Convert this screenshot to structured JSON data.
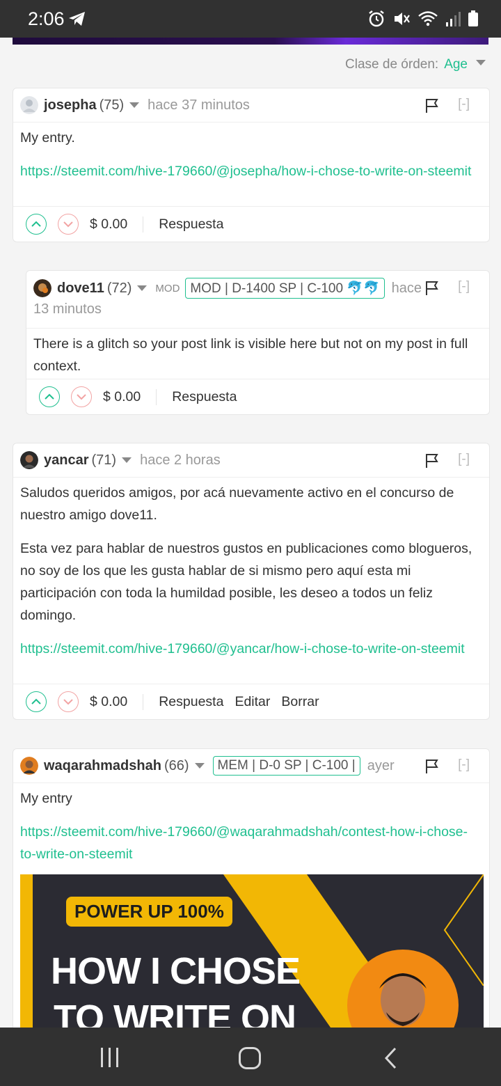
{
  "status": {
    "time": "2:06"
  },
  "sort": {
    "label": "Clase de órden:",
    "value": "Age"
  },
  "comments": [
    {
      "author": "josepha",
      "rep": "(75)",
      "time": "hace 37 minutos",
      "collapse": "[-]",
      "body": "My entry.",
      "link": "https://steemit.com/hive-179660/@josepha/how-i-chose-to-write-on-steemit",
      "payout": "$ 0.00",
      "reply": "Respuesta"
    },
    {
      "author": "dove11",
      "rep": "(72)",
      "mod": "MOD",
      "badge": "MOD | D-1400 SP | C-100 🐬🐬",
      "time_a": "hace",
      "time_b": "13 minutos",
      "collapse": "[-]",
      "body": "There is a glitch so your post link is visible here but not on my post in full context.",
      "payout": "$ 0.00",
      "reply": "Respuesta"
    },
    {
      "author": "yancar",
      "rep": "(71)",
      "time": "hace 2 horas",
      "collapse": "[-]",
      "p1": "Saludos queridos amigos, por acá nuevamente activo en el concurso de nuestro amigo dove11.",
      "p2": "Esta vez para hablar de nuestros gustos en publicaciones como blogueros, no soy de los que les gusta hablar de si mismo pero aquí esta mi participación con toda la humildad posible, les deseo a todos un feliz domingo.",
      "link": "https://steemit.com/hive-179660/@yancar/how-i-chose-to-write-on-steemit",
      "payout": "$ 0.00",
      "reply": "Respuesta",
      "edit": "Editar",
      "delete": "Borrar"
    },
    {
      "author": "waqarahmadshah",
      "rep": "(66)",
      "badge": "MEM | D-0 SP | C-100 |",
      "time": "ayer",
      "collapse": "[-]",
      "body": "My entry",
      "link": "https://steemit.com/hive-179660/@waqarahmadshah/contest-how-i-chose-to-write-on-steemit",
      "image": {
        "tag": "POWER UP 100%",
        "headline1": "HOW I CHOSE",
        "headline2": "TO WRITE ON"
      }
    }
  ],
  "colors": {
    "accent": "#1fbf8f",
    "downvote": "#f2a3a3",
    "statusbar": "#313131"
  }
}
